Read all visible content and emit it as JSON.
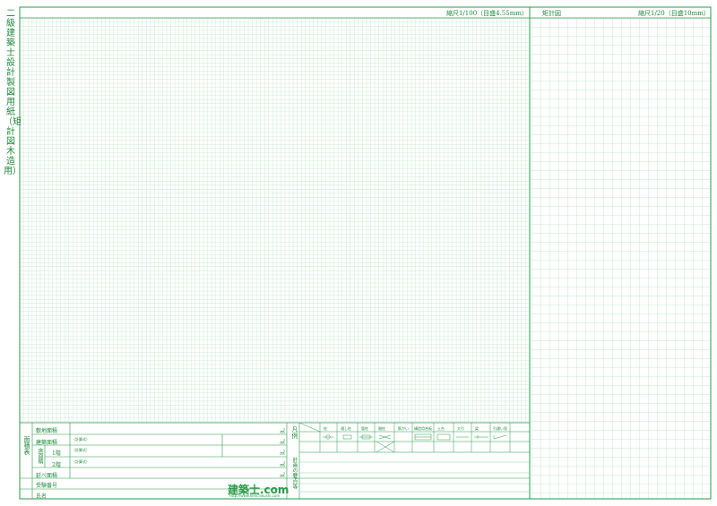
{
  "side_title": "二級建築士 設計製図用紙（矩計図 木造用）",
  "main_scale": "縮尺1/100（目盛4.55mm）",
  "section_title": "矩計図",
  "section_scale": "縮尺1/20（目盛10mm）",
  "area_table": {
    "group_label": "面積表",
    "floor_area_group": "床面積",
    "rows": {
      "site": "敷地面積",
      "building": "建築面積",
      "floor1": "1階",
      "floor2": "2階",
      "total": "延べ面積"
    },
    "calc_note": "（計算式）",
    "unit": "㎡"
  },
  "exam_no_label": "受験番号",
  "name_label": "氏名",
  "brand_name": "建築士.com",
  "brand_url": "http://www.kenchikushi.com",
  "legend_label": "凡例",
  "legend_items": [
    {
      "name": "柱"
    },
    {
      "name": "通し柱"
    },
    {
      "name": "管柱"
    },
    {
      "name": "間柱"
    },
    {
      "name": "筋かい"
    },
    {
      "name": "構造用合板"
    },
    {
      "name": "土台"
    },
    {
      "name": "大引"
    },
    {
      "name": "梁"
    },
    {
      "name": "引違い窓"
    }
  ],
  "notes_label": "計画の要点等"
}
